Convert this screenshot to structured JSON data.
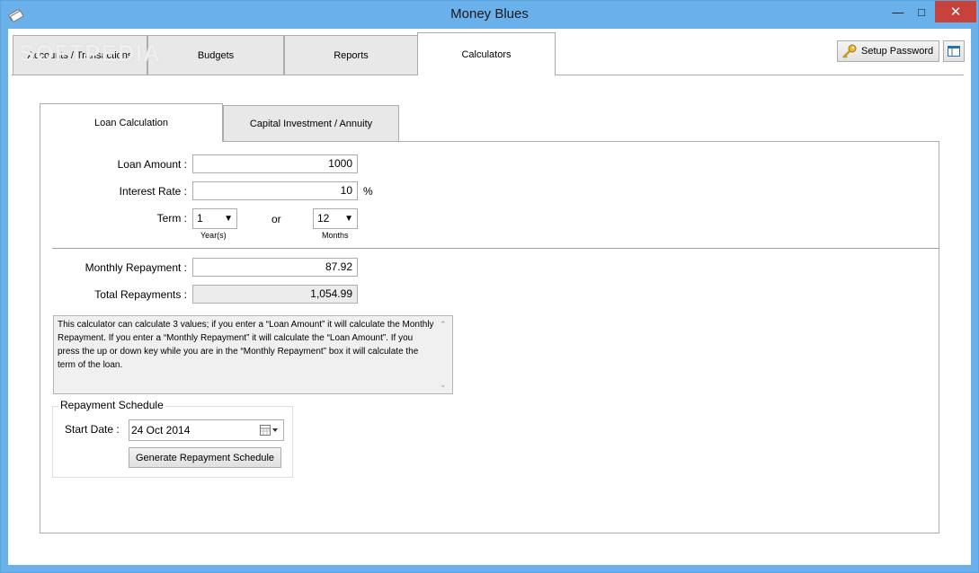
{
  "window": {
    "title": "Money Blues",
    "controls": {
      "minimize": "—",
      "maximize": "□",
      "close": "✕"
    }
  },
  "watermark": "SOFTPEDIA",
  "main_tabs": [
    {
      "label": "Accounts / Transactions"
    },
    {
      "label": "Budgets"
    },
    {
      "label": "Reports"
    },
    {
      "label": "Calculators"
    }
  ],
  "toolbar": {
    "setup_password": "Setup Password"
  },
  "sub_tabs": [
    {
      "label": "Loan Calculation"
    },
    {
      "label": "Capital Investment / Annuity"
    }
  ],
  "loan": {
    "loan_amount_label": "Loan Amount :",
    "loan_amount": "1000",
    "interest_rate_label": "Interest Rate :",
    "interest_rate": "10",
    "percent": "%",
    "term_label": "Term :",
    "term_years": "1",
    "years_caption": "Year(s)",
    "or": "or",
    "term_months": "12",
    "months_caption": "Months",
    "monthly_repayment_label": "Monthly Repayment :",
    "monthly_repayment": "87.92",
    "total_repayments_label": "Total Repayments :",
    "total_repayments": "1,054.99",
    "note": "This calculator can calculate 3 values; if you enter a “Loan Amount” it will calculate the Monthly Repayment. If you enter a “Monthly Repayment” it will calculate the “Loan Amount”. If you press the up or down key while you are in the “Monthly Repayment” box it will calculate the term of the loan."
  },
  "schedule": {
    "group_title": "Repayment Schedule",
    "start_date_label": "Start Date :",
    "start_date": "24  Oct  2014",
    "generate_button": "Generate Repayment Schedule"
  },
  "colors": {
    "titlebar": "#6ab0ea",
    "close": "#c7423b"
  }
}
